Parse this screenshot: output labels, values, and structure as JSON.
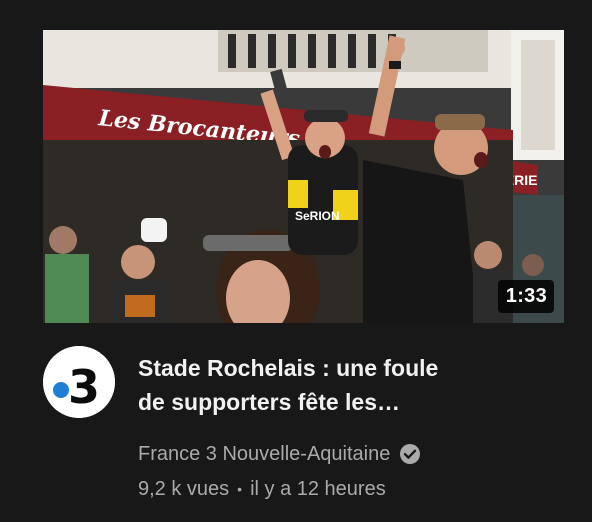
{
  "video": {
    "thumbnail": {
      "storefront_sign": "Les Brocanteurs",
      "storefront_sign_right": "ASSERIE",
      "shirt_print": "SeRION"
    },
    "duration": "1:33",
    "title_line1": "Stade Rochelais : une foule",
    "title_line2": "de supporters fête les…",
    "channel": {
      "name": "France 3 Nouvelle-Aquitaine",
      "verified": true,
      "logo_text": "3"
    },
    "views": "9,2 k vues",
    "separator": "•",
    "published": "il y a 12 heures"
  },
  "colors": {
    "background": "#181818",
    "title_text": "#f1f1f1",
    "secondary_text": "#aaaaaa",
    "logo_blue": "#1f7fd6",
    "awning_red": "#8a1f24",
    "jersey_yellow": "#f0d21a"
  }
}
